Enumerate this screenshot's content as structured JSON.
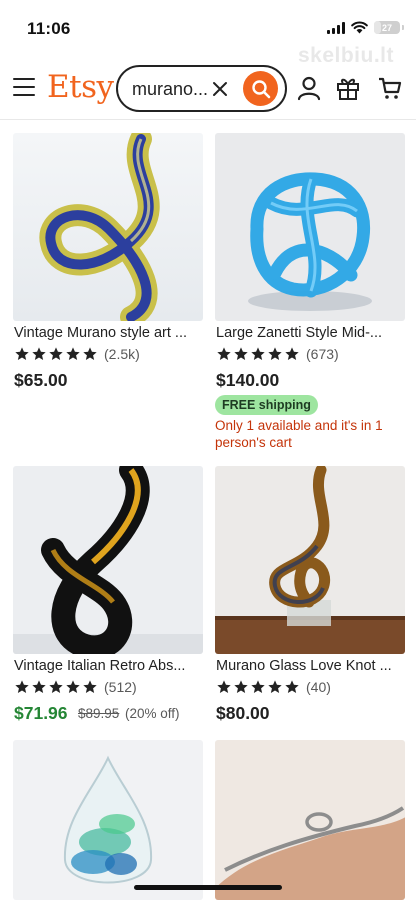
{
  "status_bar": {
    "time": "11:06",
    "battery": "27",
    "battery_fraction": 0.27
  },
  "watermark": "skelbiu.lt",
  "header": {
    "logo": "Etsy",
    "search": {
      "value": "murano..."
    }
  },
  "listings": [
    {
      "title": "Vintage Murano style art ...",
      "rating_count": "(2.5k)",
      "price": "$65.00"
    },
    {
      "title": "Large Zanetti Style Mid-...",
      "rating_count": "(673)",
      "price": "$140.00",
      "badge": "FREE shipping",
      "note": "Only 1 available and it's in 1 person's cart"
    },
    {
      "title": "Vintage Italian Retro Abs...",
      "rating_count": "(512)",
      "price": "$71.96",
      "original_price": "$89.95",
      "discount": "(20% off)"
    },
    {
      "title": "Murano Glass Love Knot ...",
      "rating_count": "(40)",
      "price": "$80.00"
    },
    {
      "title": "",
      "rating_count": "",
      "price": ""
    },
    {
      "title": "",
      "rating_count": "",
      "price": ""
    }
  ],
  "colors": {
    "brand": "#f1641e",
    "sale": "#258635",
    "badge_bg": "#9ee5a0",
    "alert": "#c4340a"
  },
  "icons": [
    "menu-icon",
    "close-icon",
    "search-icon",
    "account-icon",
    "gift-icon",
    "cart-icon",
    "star-icon"
  ]
}
